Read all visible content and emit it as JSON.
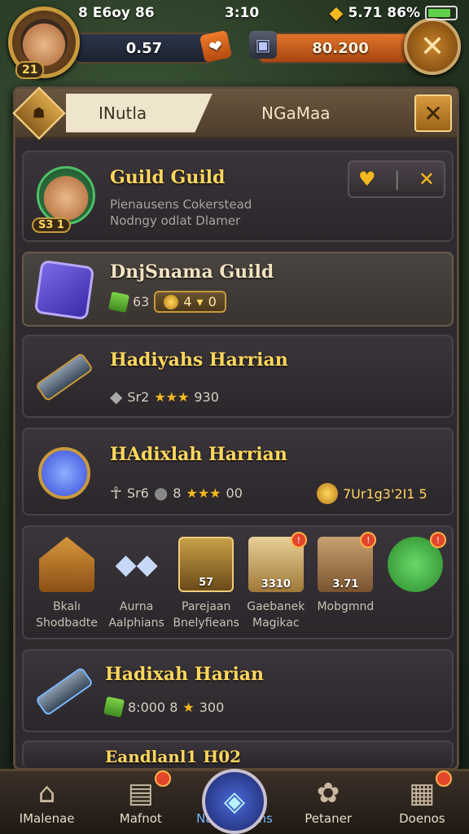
{
  "status": {
    "time_left": "8 E6oy 86",
    "time": "3:10",
    "signal": "5.71 86%"
  },
  "header": {
    "level": "21",
    "left_resource": "0.57",
    "right_resource": "80.200"
  },
  "tabs": {
    "active": "INutla",
    "inactive": "NGaMaa"
  },
  "cards": {
    "guild": {
      "title": "Guild Guild",
      "sub1": "Pienausens Cokerstead",
      "sub2": "Nodngy odlat Dlamer",
      "avatar_badge": "S3 1"
    },
    "dynasty": {
      "title": "DnjSnama  Guild",
      "gem_value": "63",
      "pill_value": "4",
      "pill_extra": "0"
    },
    "harian1": {
      "title": "Hadiyahs Harrian",
      "stat": "Sr2",
      "stars": "★★★",
      "stat_value": "930"
    },
    "harian2": {
      "title": "HAdixlah Harrian",
      "stat1": "Sr6",
      "stat2": "8",
      "stars": "★★★",
      "stat2_value": "00",
      "right_value": "7Ur1g3'2I1 5"
    },
    "harian3": {
      "title": "Hadixah Harian",
      "gem_value": "8:000 8",
      "star": "★",
      "star_value": "300"
    },
    "partial_title": "Eandlanl1 H02"
  },
  "items": [
    {
      "label1": "Bkalı",
      "label2": "Shodbadte",
      "qty": "",
      "icon": "house-icon"
    },
    {
      "label1": "Aurna",
      "label2": "Aalphians",
      "qty": "",
      "icon": "gems-icon"
    },
    {
      "label1": "Parejaan",
      "label2": "Bnelyfieans",
      "qty": "",
      "icon": "chest-icon"
    },
    {
      "label1": "Gaebanek",
      "label2": "Magikac",
      "qty": "",
      "icon": "scroll-icon"
    },
    {
      "label1": "Mobgmnd",
      "label2": "",
      "qty": "",
      "icon": "wood-icon"
    },
    {
      "label1": "",
      "label2": "",
      "qty": "",
      "icon": "orb-icon"
    }
  ],
  "item_qty": [
    "",
    "",
    "57",
    "3310",
    "3.71"
  ],
  "nav": [
    {
      "label": "IMalenae",
      "icon": "home-icon"
    },
    {
      "label": "Mafnot",
      "icon": "map-icon"
    },
    {
      "label": "Naelovarans",
      "icon": "crystal-icon"
    },
    {
      "label": "Petaner",
      "icon": "pet-icon"
    },
    {
      "label": "Doenos",
      "icon": "document-icon"
    }
  ],
  "colors": {
    "accent": "#ffd75e",
    "panel": "#2e2a2e",
    "active_nav": "#6fb7ff"
  }
}
